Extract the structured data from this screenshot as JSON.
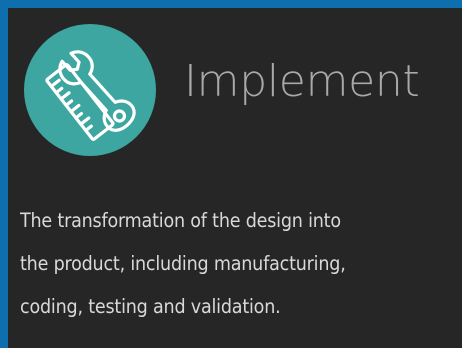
{
  "card": {
    "icon": "ruler-wrench-icon",
    "title": "Implement",
    "description_lines": [
      "The transformation of the design into",
      "the product, including manufacturing,",
      "coding, testing and validation."
    ]
  },
  "colors": {
    "border_blue": "#0e6fae",
    "card_background": "#262626",
    "icon_circle": "#3ea6a0",
    "title_text": "#a9a9a9",
    "body_text": "#d9d9d9"
  }
}
